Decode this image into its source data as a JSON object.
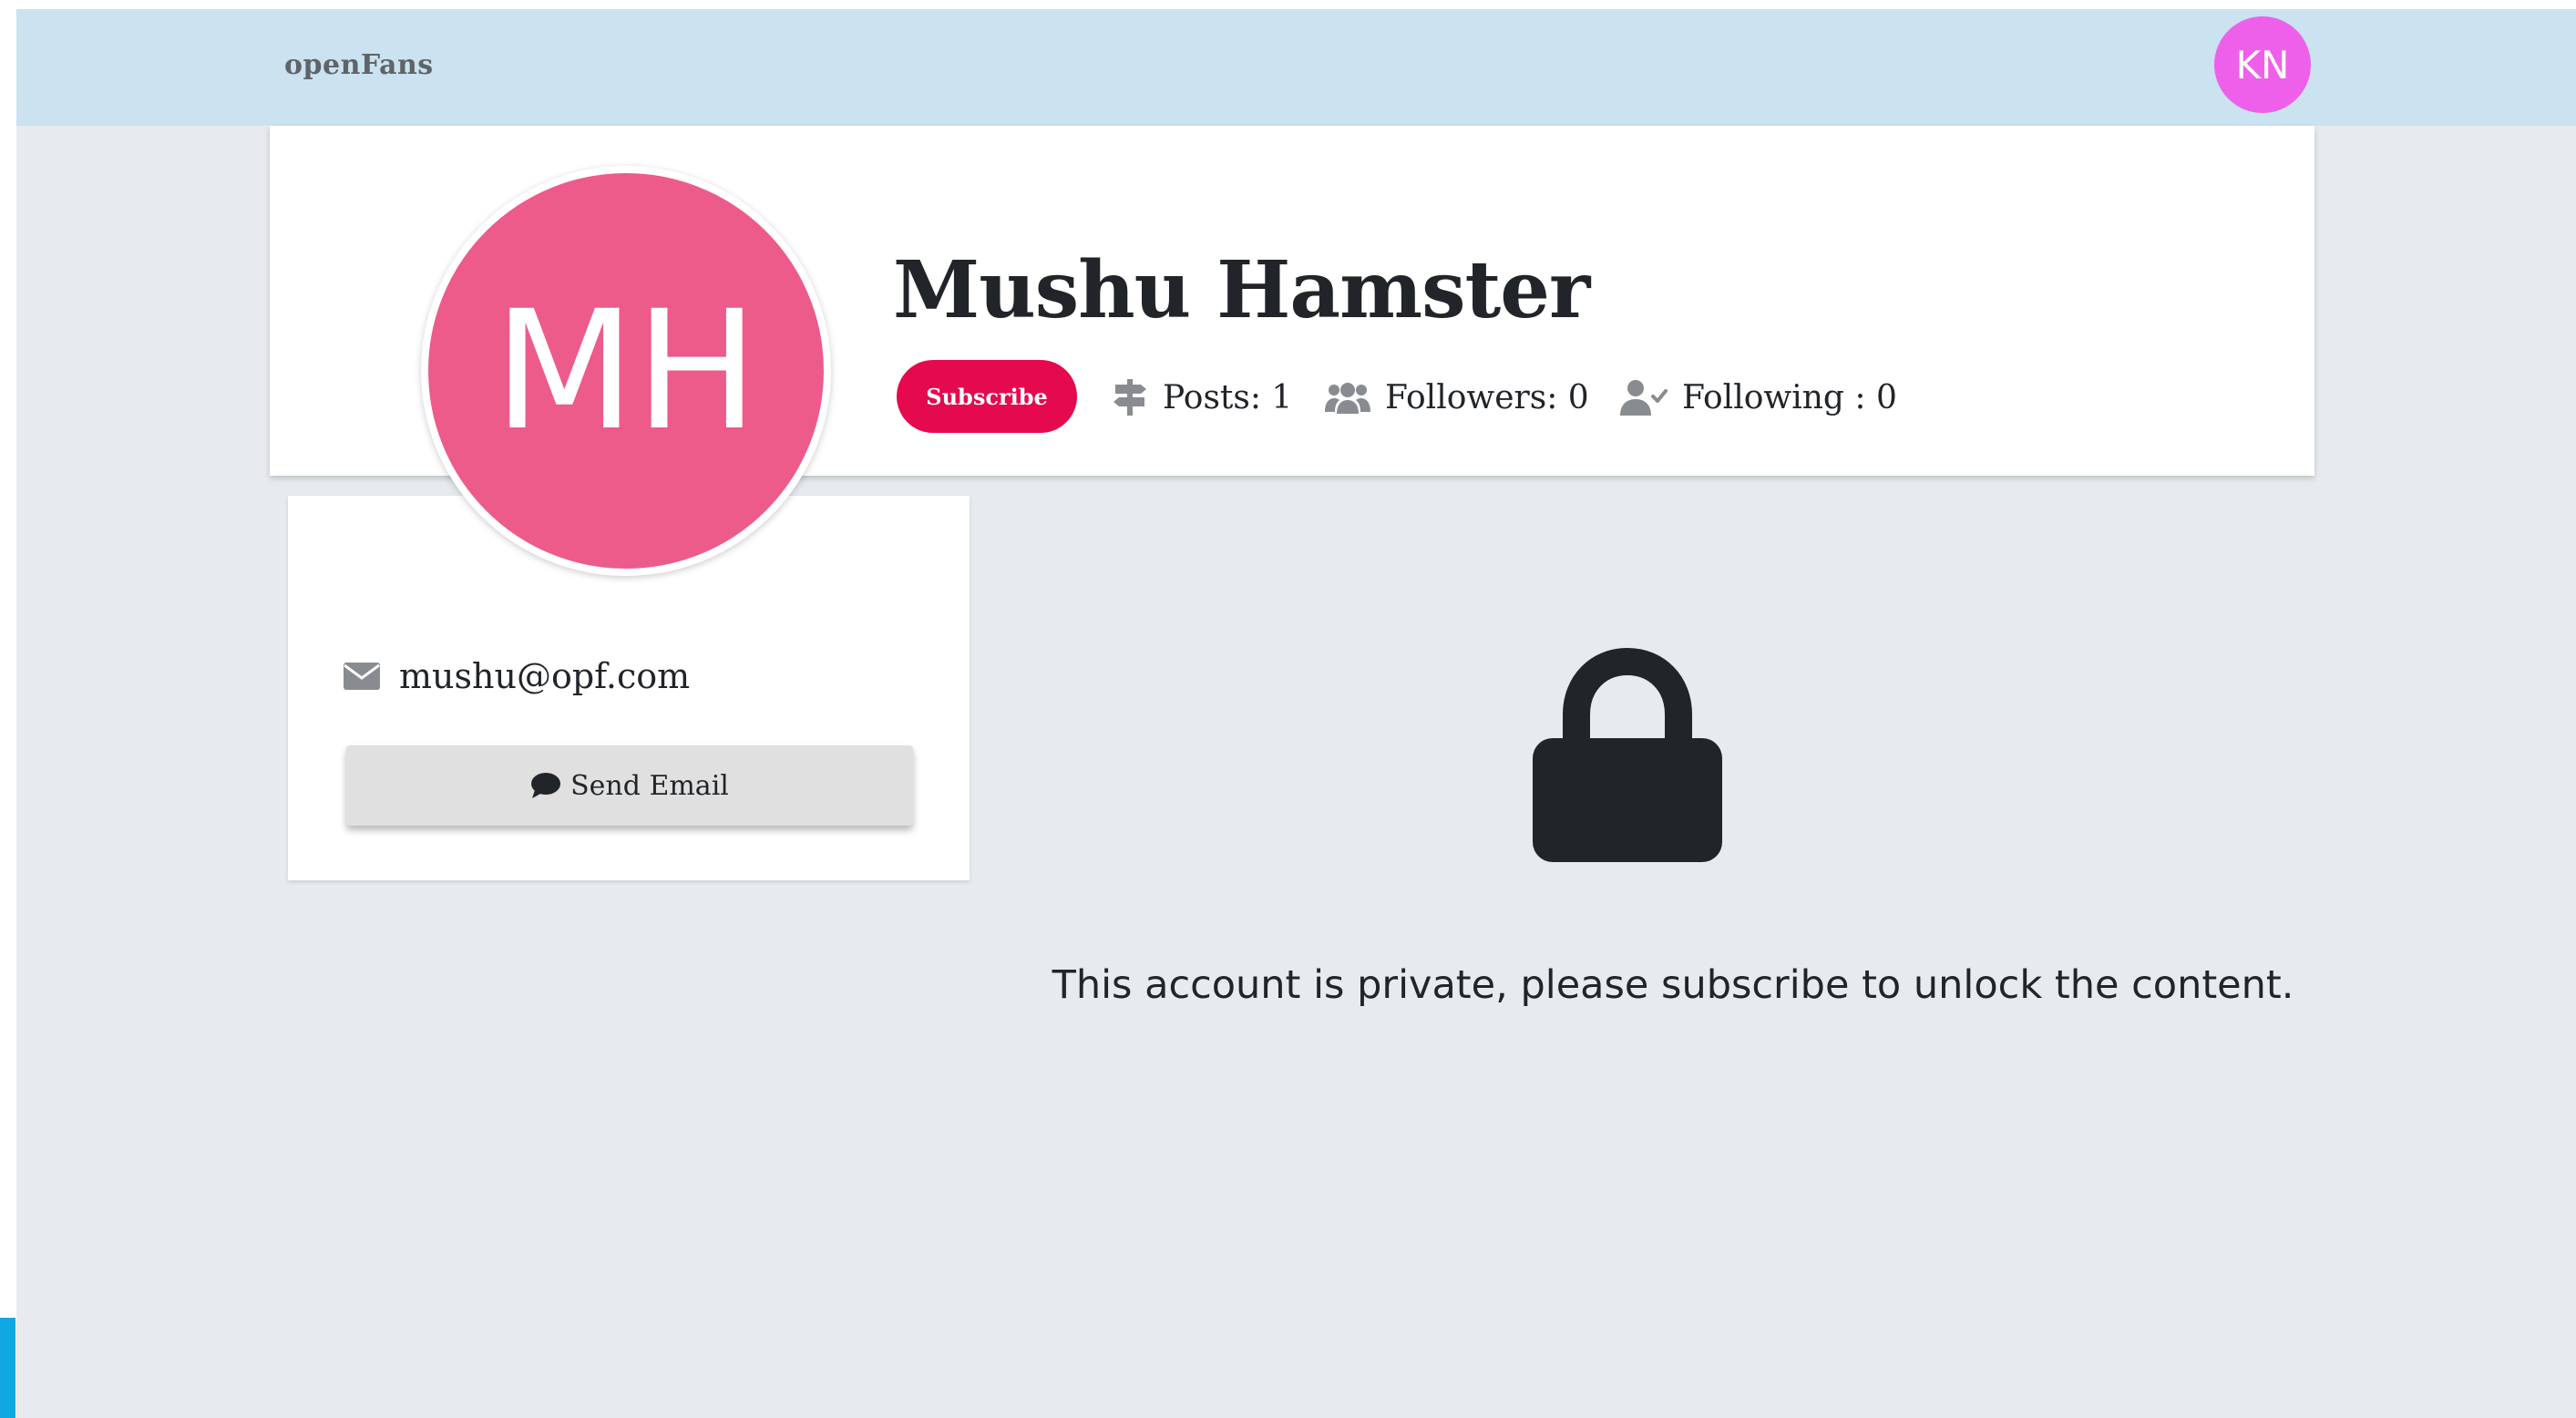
{
  "navbar": {
    "brand": "openFans",
    "user_initials": "KN"
  },
  "profile": {
    "initials": "MH",
    "name": "Mushu Hamster",
    "subscribe_label": "Subscribe",
    "stats": {
      "posts": "Posts: 1",
      "followers": "Followers: 0",
      "following": "Following : 0"
    },
    "email": "mushu@opf.com",
    "send_email_label": "Send Email"
  },
  "content": {
    "private_message": "This account is private, please subscribe to unlock the content."
  },
  "icons": {
    "posts": "signpost-icon",
    "followers": "users-icon",
    "following": "user-check-icon",
    "email": "envelope-icon",
    "send": "comment-icon",
    "lock": "lock-icon"
  },
  "colors": {
    "navbar_bg": "#cbe2f1",
    "page_bg": "#e7ebef",
    "user_avatar": "#ee60ea",
    "profile_avatar": "#ed5b8a",
    "subscribe": "#e5094d",
    "scroll_indicator": "#0fa8e2"
  }
}
